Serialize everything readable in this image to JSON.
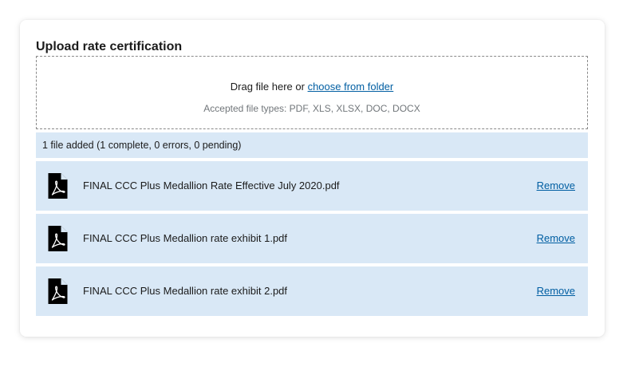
{
  "upload": {
    "title": "Upload rate certification",
    "drop_text": "Drag file here or ",
    "choose_link": "choose from folder",
    "accepted_types": "Accepted file types: PDF, XLS, XLSX, DOC, DOCX"
  },
  "status": {
    "summary": "1 file added (1 complete, 0 errors, 0 pending)"
  },
  "files": [
    {
      "name": "FINAL CCC Plus Medallion Rate Effective July 2020.pdf",
      "remove_label": "Remove",
      "icon": "pdf-file-icon"
    },
    {
      "name": "FINAL CCC Plus Medallion rate exhibit 1.pdf",
      "remove_label": "Remove",
      "icon": "pdf-file-icon"
    },
    {
      "name": "FINAL CCC Plus Medallion rate exhibit 2.pdf",
      "remove_label": "Remove",
      "icon": "pdf-file-icon"
    }
  ],
  "colors": {
    "row_background": "#d9e8f6",
    "link": "#005ea2",
    "text": "#1b1b1b",
    "hint": "#71767a"
  }
}
